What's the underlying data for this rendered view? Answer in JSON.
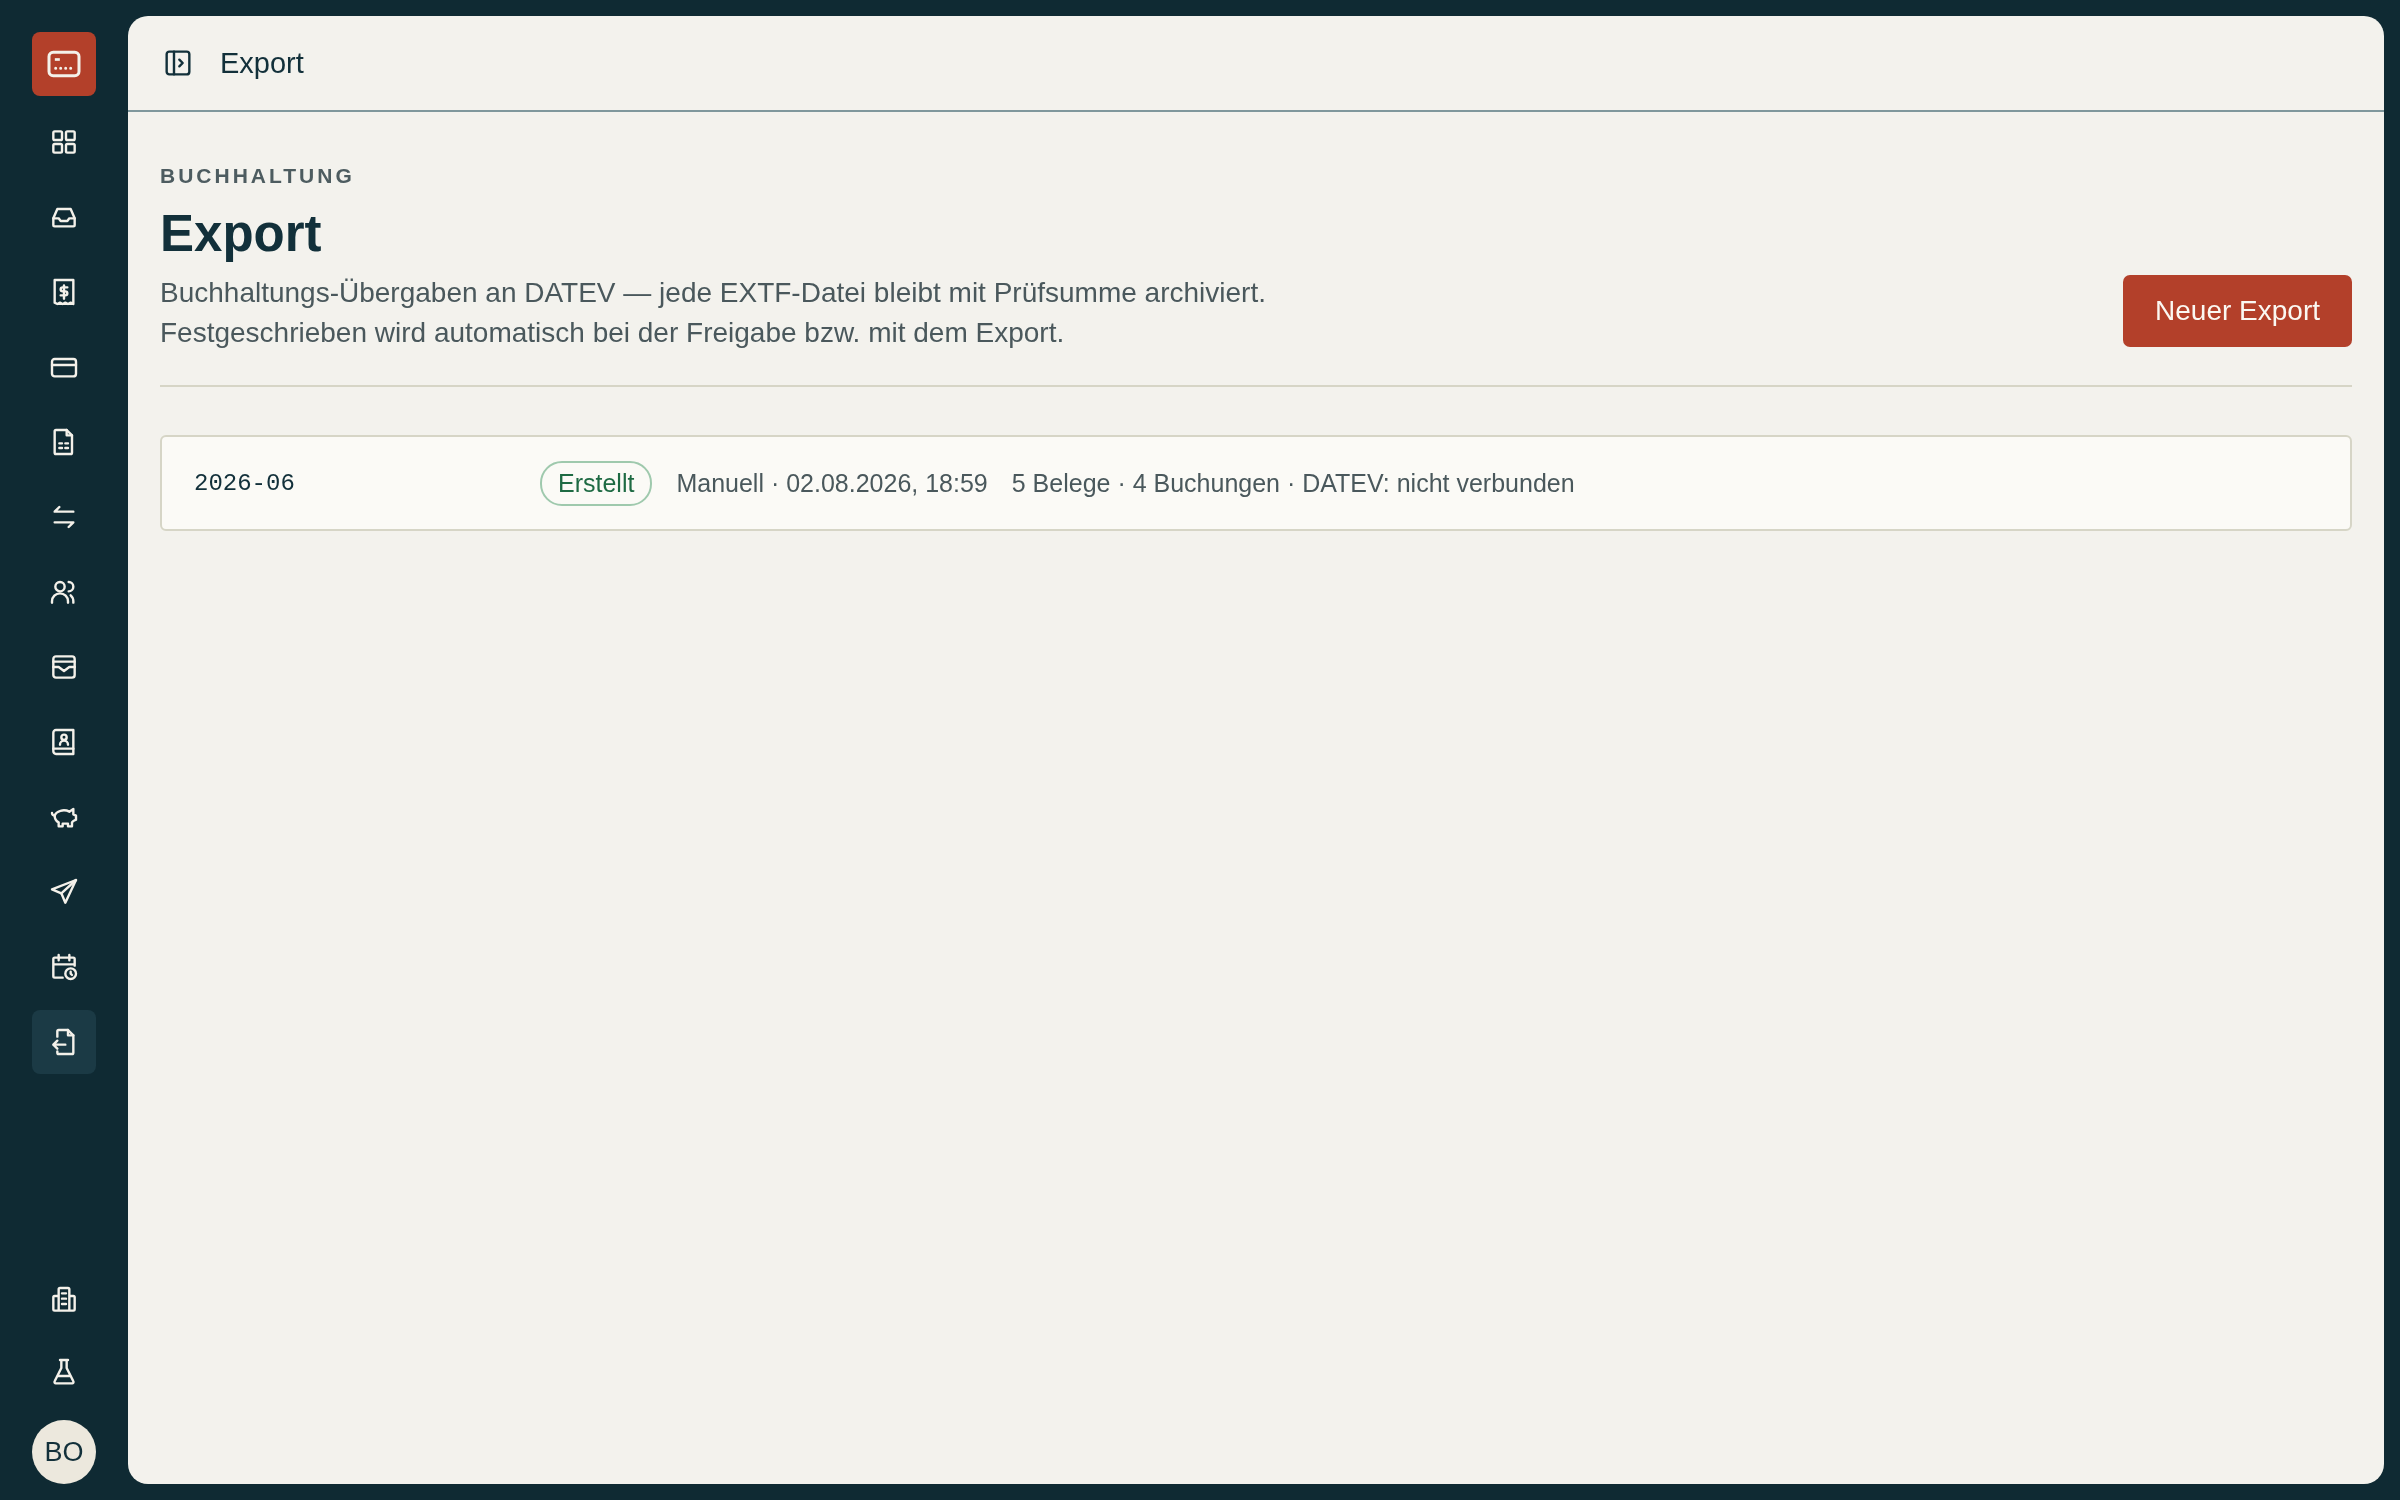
{
  "sidebar": {
    "items": [
      {
        "selected": false
      },
      {
        "selected": false
      },
      {
        "selected": false
      },
      {
        "selected": false
      },
      {
        "selected": false
      },
      {
        "selected": false
      },
      {
        "selected": false
      },
      {
        "selected": false
      },
      {
        "selected": false
      },
      {
        "selected": false
      },
      {
        "selected": false
      },
      {
        "selected": false
      },
      {
        "selected": true
      }
    ],
    "footer_items": [
      {
        "selected": false
      },
      {
        "selected": false
      }
    ],
    "avatar": "BO"
  },
  "header": {
    "title": "Export"
  },
  "page": {
    "eyebrow": "BUCHHALTUNG",
    "title": "Export",
    "description": "Buchhaltungs-Übergaben an DATEV — jede EXTF-Datei bleibt mit Prüfsumme archiviert. Festgeschrieben wird automatisch bei der Freigabe bzw. mit dem Export.",
    "primary_button": "Neuer Export"
  },
  "exports": [
    {
      "period": "2026-06",
      "status": "Erstellt",
      "source": "Manuell · 02.08.2026, 18:59",
      "summary": "5 Belege · 4 Buchungen · DATEV: nicht verbunden"
    }
  ]
}
